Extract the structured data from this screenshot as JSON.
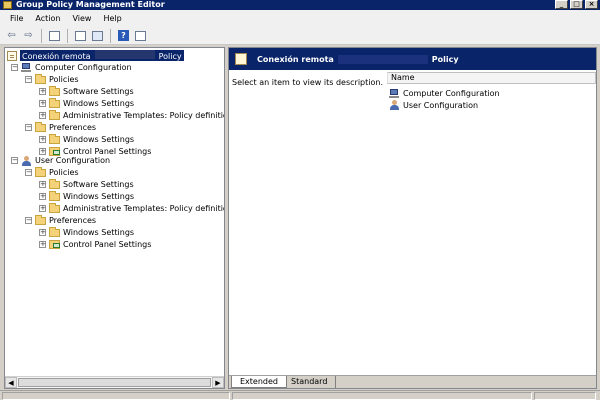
{
  "window": {
    "title": "Group Policy Management Editor",
    "buttons": [
      "_",
      "□",
      "×"
    ]
  },
  "menubar": {
    "items": [
      "File",
      "Action",
      "View",
      "Help"
    ]
  },
  "toolbar": {
    "buttons": [
      {
        "icon": "back-arrow-icon",
        "glyph": "⇦"
      },
      {
        "icon": "forward-arrow-icon",
        "glyph": "⇨"
      },
      {
        "icon": "show-hide-tree-icon"
      },
      {
        "icon": "properties-icon"
      },
      {
        "icon": "export-list-icon"
      },
      {
        "icon": "help-icon",
        "glyph": "?"
      },
      {
        "icon": "show-hide-action-pane-icon"
      }
    ]
  },
  "tree": {
    "root": {
      "label": "Conexión remota",
      "suffix": "Policy",
      "icon": "policy-document-icon"
    },
    "computer": {
      "label": "Computer Configuration",
      "policies": "Policies",
      "software": "Software Settings",
      "windows": "Windows Settings",
      "admin": "Administrative Templates: Policy definitions (",
      "preferences": "Preferences",
      "pref_windows": "Windows Settings",
      "pref_control": "Control Panel Settings"
    },
    "user": {
      "label": "User Configuration",
      "policies": "Policies",
      "software": "Software Settings",
      "windows": "Windows Settings",
      "admin": "Administrative Templates: Policy definitions (",
      "preferences": "Preferences",
      "pref_windows": "Windows Settings",
      "pref_control": "Control Panel Settings"
    },
    "expand_glyphs": {
      "expanded": "−",
      "collapsed": "+"
    }
  },
  "right": {
    "header_title": "Conexión remota",
    "header_suffix": "Policy",
    "description": "Select an item to view its description.",
    "column_name": "Name",
    "items": [
      "Computer Configuration",
      "User Configuration"
    ],
    "tabs": [
      "Extended",
      "Standard"
    ]
  },
  "scroll": {
    "left": "◀",
    "right": "▶"
  }
}
